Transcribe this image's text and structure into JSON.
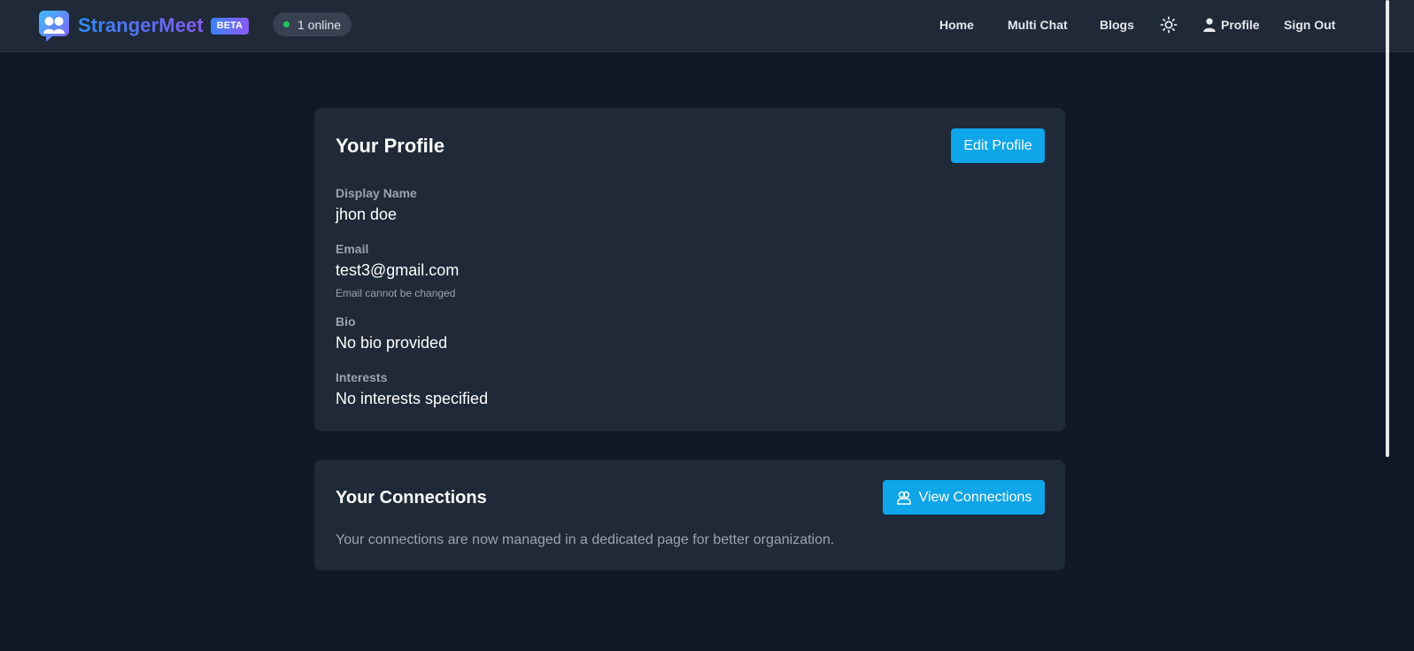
{
  "header": {
    "brand_name": "StrangerMeet",
    "beta_badge": "BETA",
    "online_status": "1 online",
    "nav": {
      "home": "Home",
      "multi_chat": "Multi Chat",
      "blogs": "Blogs",
      "theme_icon": "sun-icon",
      "profile": "Profile",
      "sign_out": "Sign Out"
    }
  },
  "profile": {
    "title": "Your Profile",
    "edit_button": "Edit Profile",
    "display_name_label": "Display Name",
    "display_name_value": "jhon doe",
    "email_label": "Email",
    "email_value": "test3@gmail.com",
    "email_hint": "Email cannot be changed",
    "bio_label": "Bio",
    "bio_value": "No bio provided",
    "interests_label": "Interests",
    "interests_value": "No interests specified"
  },
  "connections": {
    "title": "Your Connections",
    "view_button": "View Connections",
    "description": "Your connections are now managed in a dedicated page for better organization."
  },
  "colors": {
    "background": "#111827",
    "card": "#1f2937",
    "accent": "#0ea5e9",
    "online": "#22c55e"
  }
}
